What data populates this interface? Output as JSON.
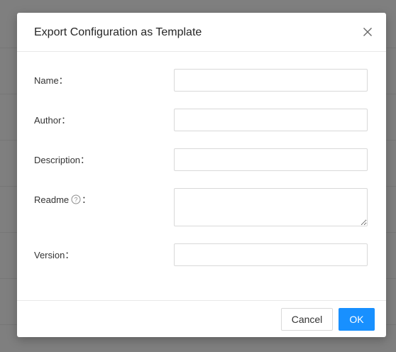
{
  "modal": {
    "title": "Export Configuration as Template",
    "close_icon": "close-icon"
  },
  "form": {
    "fields": [
      {
        "label": "Name：",
        "value": "",
        "type": "input"
      },
      {
        "label": "Author：",
        "value": "",
        "type": "input"
      },
      {
        "label": "Description：",
        "value": "",
        "type": "input"
      },
      {
        "label": "Readme",
        "suffix": "：",
        "value": "",
        "type": "textarea",
        "help_icon": "help-circle-icon"
      },
      {
        "label": "Version：",
        "value": "",
        "type": "input"
      }
    ]
  },
  "footer": {
    "cancel_label": "Cancel",
    "ok_label": "OK"
  },
  "colors": {
    "primary": "#1890ff",
    "overlay": "#7f7f7f",
    "border": "#d9d9d9"
  }
}
